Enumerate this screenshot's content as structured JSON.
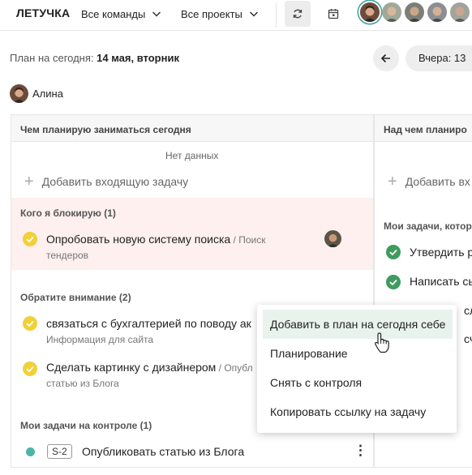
{
  "header": {
    "logo": "ЛЕТУЧКА",
    "teams_dropdown": "Все команды",
    "projects_dropdown": "Все проекты",
    "colors": {
      "accent": "#3aa39a"
    }
  },
  "subheader": {
    "plan_label": "План на сегодня:",
    "plan_date": "14 мая, вторник",
    "yesterday_label": "Вчера: 13"
  },
  "user": {
    "name": "Алина"
  },
  "left_column": {
    "header": "Чем планирую заниматься сегодня",
    "no_data": "Нет данных",
    "add_label": "Добавить входящую задачу",
    "blocking": {
      "title": "Кого я блокирую (1)",
      "tasks": [
        {
          "title": "Опробовать новую систему поиска",
          "sep": " / ",
          "project_1": "Поиск",
          "project_2": "тендеров"
        }
      ]
    },
    "attention": {
      "title": "Обратите внимание (2)",
      "tasks": [
        {
          "title": "связаться с бухгалтерией по поводу ак",
          "project": "Информация для сайта"
        },
        {
          "title": "Сделать картинку с дизайнером",
          "sep": " / ",
          "project_1": "Опубл",
          "project_2": "статью из Блога"
        }
      ]
    },
    "control": {
      "title": "Мои задачи на контроле (1)",
      "tasks": [
        {
          "id": "S-2",
          "title": "Опубликовать статью из Блога",
          "more": "⋮"
        }
      ]
    }
  },
  "right_column": {
    "header": "Над чем планиро",
    "add_label": "Добавить вх",
    "my_tasks_title": "Мои задачи, котор",
    "tasks": [
      {
        "title": "Утвердить р"
      },
      {
        "title": "Написать сь"
      },
      {
        "title": "сл"
      },
      {
        "title": "сч"
      }
    ]
  },
  "context_menu": {
    "items": [
      {
        "label": "Добавить в план на сегодня себе"
      },
      {
        "label": "Планирование"
      },
      {
        "label": "Снять с контроля"
      },
      {
        "label": "Копировать ссылку на задачу"
      }
    ]
  }
}
